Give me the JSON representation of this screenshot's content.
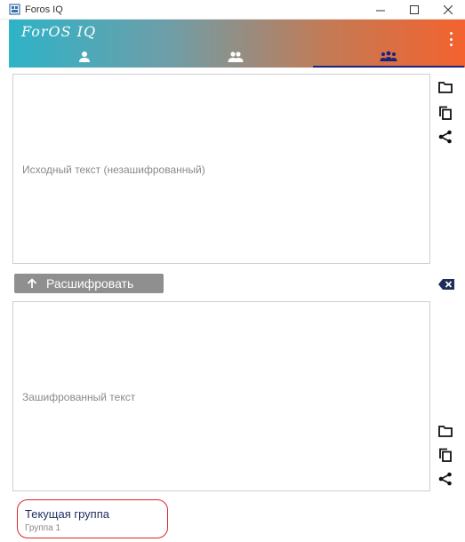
{
  "window": {
    "title": "Foros IQ"
  },
  "header": {
    "brand": "ForOS IQ"
  },
  "tabs": [
    {
      "icon": "person-icon",
      "active": false
    },
    {
      "icon": "people-icon",
      "active": false
    },
    {
      "icon": "group-icon",
      "active": true
    }
  ],
  "source_box": {
    "placeholder": "Исходный текст (незашифрованный)"
  },
  "decrypt_button": {
    "label": "Расшифровать"
  },
  "encrypted_box": {
    "placeholder": "Зашифрованный текст"
  },
  "current_group": {
    "title": "Текущая группа",
    "name": "Группа 1"
  },
  "colors": {
    "gradient_start": "#2eb3c7",
    "gradient_end": "#f4622e",
    "active_tab": "#1a237e",
    "highlight": "#d9262b",
    "button": "#8f8f8f"
  }
}
